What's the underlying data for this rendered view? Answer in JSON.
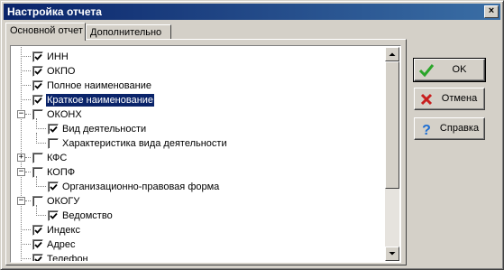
{
  "window": {
    "title": "Настройка отчета",
    "close_glyph": "×"
  },
  "tabs": [
    {
      "label": "Основной отчет",
      "active": true
    },
    {
      "label": "Дополнительно",
      "active": false
    }
  ],
  "tree": {
    "items": [
      {
        "label": "ИНН",
        "checked": true,
        "level": 0,
        "selected": false
      },
      {
        "label": "ОКПО",
        "checked": true,
        "level": 0,
        "selected": false
      },
      {
        "label": "Полное наименование",
        "checked": true,
        "level": 0,
        "selected": false
      },
      {
        "label": "Краткое наименование",
        "checked": true,
        "level": 0,
        "selected": true
      },
      {
        "label": "ОКОНХ",
        "checked": false,
        "level": 0,
        "expander": "minus"
      },
      {
        "label": "Вид деятельности",
        "checked": true,
        "level": 1
      },
      {
        "label": "Характеристика вида деятельности",
        "checked": false,
        "level": 1
      },
      {
        "label": "КФС",
        "checked": false,
        "level": 0,
        "expander": "plus"
      },
      {
        "label": "КОПФ",
        "checked": false,
        "level": 0,
        "expander": "minus"
      },
      {
        "label": "Организационно-правовая форма",
        "checked": true,
        "level": 1
      },
      {
        "label": "ОКОГУ",
        "checked": false,
        "level": 0,
        "expander": "minus"
      },
      {
        "label": "Ведомство",
        "checked": true,
        "level": 1
      },
      {
        "label": "Индекс",
        "checked": true,
        "level": 0
      },
      {
        "label": "Адрес",
        "checked": true,
        "level": 0
      },
      {
        "label": "Телефон",
        "checked": true,
        "level": 0
      }
    ],
    "scroll_position": 0.0
  },
  "buttons": {
    "ok": {
      "label": "OK",
      "icon": "checkmark-icon",
      "color": "#2aa52a"
    },
    "cancel": {
      "label": "Отмена",
      "icon": "x-icon",
      "color": "#c81e1e"
    },
    "help": {
      "label": "Справка",
      "icon": "question-icon",
      "color": "#1e6ed2"
    }
  },
  "colors": {
    "title_bar": "#0a246a",
    "selection": "#0a246a",
    "face": "#d4d0c8"
  }
}
